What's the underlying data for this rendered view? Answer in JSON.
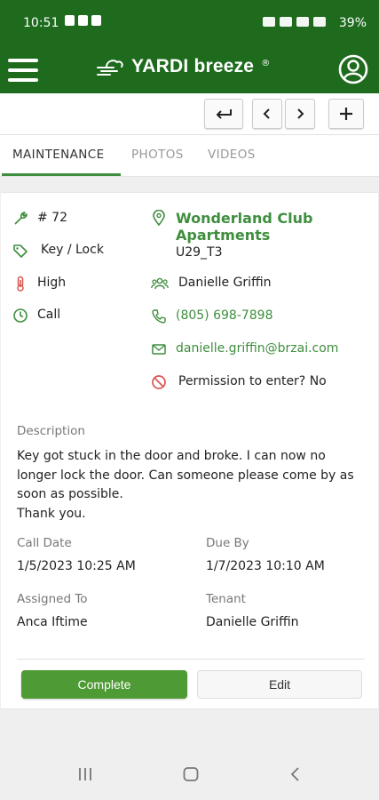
{
  "status_bar": {
    "time": "10:51",
    "battery": "39%"
  },
  "app_bar": {
    "brand": "YARDI breeze",
    "registered": "®"
  },
  "tabs": [
    {
      "label": "MAINTENANCE",
      "active": true
    },
    {
      "label": "PHOTOS",
      "active": false
    },
    {
      "label": "VIDEOS",
      "active": false
    }
  ],
  "work_order": {
    "number": "# 72",
    "category": "Key / Lock",
    "priority": "High",
    "source": "Call",
    "property_name": "Wonderland Club Apartments",
    "unit": "U29_T3",
    "contact_name": "Danielle Griffin",
    "phone": "(805) 698-7898",
    "email": "danielle.griffin@brzai.com",
    "permission": "Permission to enter? No"
  },
  "description": {
    "label": "Description",
    "text": "Key got stuck in the door and broke. I can now no longer lock the door. Can someone please come by as soon as possible.\nThank you."
  },
  "details": {
    "call_date_label": "Call Date",
    "call_date": "1/5/2023 10:25 AM",
    "due_by_label": "Due By",
    "due_by": "1/7/2023 10:10 AM",
    "assigned_to_label": "Assigned To",
    "assigned_to": "Anca Iftime",
    "tenant_label": "Tenant",
    "tenant": "Danielle Griffin"
  },
  "actions": {
    "complete": "Complete",
    "edit": "Edit"
  },
  "colors": {
    "header": "#1e6b1e",
    "accent": "#3e8e3e",
    "priority_red": "#d9534f",
    "deny_red": "#d9534f"
  }
}
